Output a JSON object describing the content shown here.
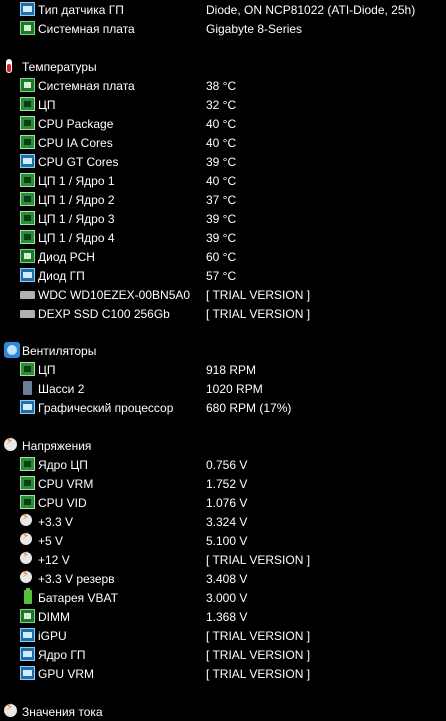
{
  "top": [
    {
      "label": "Тип датчика ГП",
      "value": "Diode, ON NCP81022  (ATI-Diode, 25h)",
      "icon": "gpu-icon"
    },
    {
      "label": "Системная плата",
      "value": "Gigabyte 8-Series",
      "icon": "motherboard-icon"
    }
  ],
  "temps": {
    "title": "Температуры",
    "items": [
      {
        "label": "Системная плата",
        "value": "38 °C",
        "icon": "motherboard-icon"
      },
      {
        "label": "ЦП",
        "value": "32 °C",
        "icon": "cpu-icon"
      },
      {
        "label": "CPU Package",
        "value": "40 °C",
        "icon": "cpu-icon"
      },
      {
        "label": "CPU IA Cores",
        "value": "40 °C",
        "icon": "cpu-icon"
      },
      {
        "label": "CPU GT Cores",
        "value": "39 °C",
        "icon": "gpu-icon"
      },
      {
        "label": "ЦП 1 / Ядро 1",
        "value": "40 °C",
        "icon": "cpu-icon"
      },
      {
        "label": "ЦП 1 / Ядро 2",
        "value": "37 °C",
        "icon": "cpu-icon"
      },
      {
        "label": "ЦП 1 / Ядро 3",
        "value": "39 °C",
        "icon": "cpu-icon"
      },
      {
        "label": "ЦП 1 / Ядро 4",
        "value": "39 °C",
        "icon": "cpu-icon"
      },
      {
        "label": "Диод PCH",
        "value": "60 °C",
        "icon": "chip-icon"
      },
      {
        "label": "Диод ГП",
        "value": "57 °C",
        "icon": "gpu-icon"
      },
      {
        "label": "WDC WD10EZEX-00BN5A0",
        "value": "[ TRIAL VERSION ]",
        "icon": "drive-icon"
      },
      {
        "label": "DEXP SSD C100 256Gb",
        "value": "[ TRIAL VERSION ]",
        "icon": "drive-icon"
      }
    ]
  },
  "fans": {
    "title": "Вентиляторы",
    "items": [
      {
        "label": "ЦП",
        "value": "918 RPM",
        "icon": "cpu-icon"
      },
      {
        "label": "Шасси 2",
        "value": "1020 RPM",
        "icon": "case-icon"
      },
      {
        "label": "Графический процессор",
        "value": "680 RPM  (17%)",
        "icon": "gpu-icon"
      }
    ]
  },
  "volts": {
    "title": "Напряжения",
    "items": [
      {
        "label": "Ядро ЦП",
        "value": "0.756 V",
        "icon": "cpu-icon"
      },
      {
        "label": "CPU VRM",
        "value": "1.752 V",
        "icon": "cpu-icon"
      },
      {
        "label": "CPU VID",
        "value": "1.076 V",
        "icon": "cpu-icon"
      },
      {
        "label": "+3.3 V",
        "value": "3.324 V",
        "icon": "voltage-icon"
      },
      {
        "label": "+5 V",
        "value": "5.100 V",
        "icon": "voltage-icon"
      },
      {
        "label": "+12 V",
        "value": "[ TRIAL VERSION ]",
        "icon": "voltage-icon"
      },
      {
        "label": "+3.3 V резерв",
        "value": "3.408 V",
        "icon": "voltage-icon"
      },
      {
        "label": "Батарея VBAT",
        "value": "3.000 V",
        "icon": "battery-icon"
      },
      {
        "label": "DIMM",
        "value": "1.368 V",
        "icon": "memory-icon"
      },
      {
        "label": "iGPU",
        "value": "[ TRIAL VERSION ]",
        "icon": "gpu-icon"
      },
      {
        "label": "Ядро ГП",
        "value": "[ TRIAL VERSION ]",
        "icon": "gpu-icon"
      },
      {
        "label": "GPU VRM",
        "value": "[ TRIAL VERSION ]",
        "icon": "gpu-icon"
      }
    ]
  },
  "current": {
    "title": "Значения тока"
  }
}
